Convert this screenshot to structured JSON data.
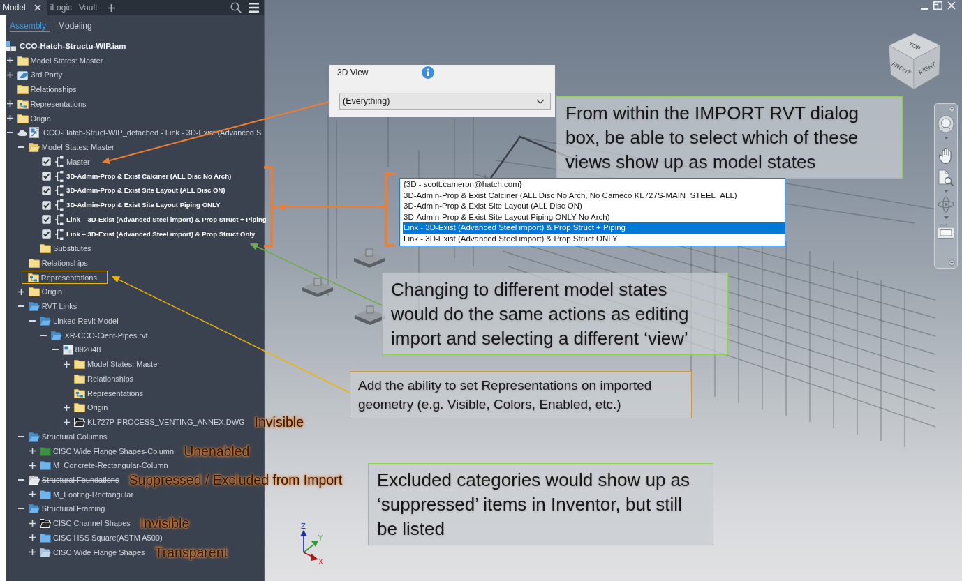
{
  "panel": {
    "tabs": [
      {
        "label": "Model",
        "selected": true,
        "closable": true
      },
      {
        "label": "iLogic",
        "selected": false,
        "closable": false
      },
      {
        "label": "Vault",
        "selected": false,
        "closable": false
      }
    ],
    "view_tabs": [
      {
        "label": "Assembly",
        "selected": true
      },
      {
        "label": "Modeling",
        "selected": false
      }
    ],
    "tree": {
      "label": "CCO-Hatch-Structu-WIP.iam",
      "kind": "assembly",
      "children": [
        {
          "label": "Model States: Master",
          "kind": "folder",
          "expanded": false
        },
        {
          "label": "3rd Party",
          "kind": "third-party",
          "expanded": false
        },
        {
          "label": "Relationships",
          "kind": "folder"
        },
        {
          "label": "Representations",
          "kind": "representations",
          "expanded": false
        },
        {
          "label": "Origin",
          "kind": "folder",
          "expanded": false
        },
        {
          "label": "CCO-Hatch-Struct-WIP_detached - Link - 3D-Exist (Advanced S",
          "kind": "linked-file",
          "expanded": true,
          "children": [
            {
              "label": "Model States: Master",
              "kind": "folder",
              "expanded": true,
              "children": [
                {
                  "label": "Master",
                  "kind": "model-state",
                  "checked": true,
                  "proposed": false
                },
                {
                  "label": "3D-Admin-Prop & Exist Calciner (ALL Disc No Arch)",
                  "kind": "model-state",
                  "checked": true,
                  "proposed": true
                },
                {
                  "label": "3D-Admin-Prop & Exist Site Layout (ALL Disc ON)",
                  "kind": "model-state",
                  "checked": true,
                  "proposed": true
                },
                {
                  "label": "3D-Admin-Prop & Exist Site Layout Piping ONLY",
                  "kind": "model-state",
                  "checked": true,
                  "proposed": true
                },
                {
                  "label": "Link – 3D-Exist (Advanced Steel import) & Prop Struct + Piping",
                  "kind": "model-state",
                  "checked": true,
                  "proposed": true
                },
                {
                  "label": "Link – 3D-Exist (Advanced Steel import) & Prop Struct Only",
                  "kind": "model-state",
                  "checked": true,
                  "proposed": true
                },
                {
                  "label": "Substitutes",
                  "kind": "folder"
                }
              ]
            },
            {
              "label": "Relationships",
              "kind": "folder"
            },
            {
              "label": "Representations",
              "kind": "representations",
              "highlighted": true
            },
            {
              "label": "Origin",
              "kind": "folder",
              "expanded": false
            },
            {
              "label": "RVT Links",
              "kind": "category",
              "expanded": true,
              "children": [
                {
                  "label": "Linked Revit Model",
                  "kind": "category",
                  "expanded": true,
                  "children": [
                    {
                      "label": "XR-CCO-Cient-Pipes.rvt",
                      "kind": "category",
                      "expanded": true,
                      "children": [
                        {
                          "label": "892048",
                          "kind": "revit-model",
                          "expanded": true,
                          "children": [
                            {
                              "label": "Model States: Master",
                              "kind": "folder",
                              "expanded": false
                            },
                            {
                              "label": "Relationships",
                              "kind": "folder"
                            },
                            {
                              "label": "Representations",
                              "kind": "representations"
                            },
                            {
                              "label": "Origin",
                              "kind": "folder",
                              "expanded": false
                            },
                            {
                              "label": "KL727P-PROCESS_VENTING_ANNEX.DWG",
                              "kind": "invisible-category",
                              "expanded": false,
                              "note": "Invisible"
                            }
                          ]
                        }
                      ]
                    }
                  ]
                }
              ]
            },
            {
              "label": "Structural Columns",
              "kind": "category",
              "expanded": true,
              "children": [
                {
                  "label": "CISC Wide Flange Shapes-Column",
                  "kind": "unenabled-category",
                  "expanded": false,
                  "note": "Unenabled"
                },
                {
                  "label": "M_Concrete-Rectangular-Column",
                  "kind": "category",
                  "expanded": false
                }
              ]
            },
            {
              "label": "Structural Foundations",
              "kind": "suppressed-category",
              "expanded": true,
              "note": "Suppressed / Excluded from Import",
              "children": [
                {
                  "label": "M_Footing-Rectangular",
                  "kind": "category",
                  "expanded": false
                }
              ]
            },
            {
              "label": "Structural Framing",
              "kind": "category",
              "expanded": true,
              "children": [
                {
                  "label": "CISC Channel Shapes",
                  "kind": "invisible-category",
                  "expanded": false,
                  "note": "Invisible"
                },
                {
                  "label": "CISC HSS Square(ASTM A500)",
                  "kind": "category",
                  "expanded": false
                },
                {
                  "label": "CISC Wide Flange Shapes",
                  "kind": "transparent-category",
                  "expanded": false,
                  "note": "Transparent"
                }
              ]
            }
          ]
        }
      ]
    }
  },
  "viewport": {
    "view_cube": {
      "top": "TOP",
      "front": "FRONT",
      "right": "RIGHT"
    },
    "axis_triad": {
      "z": "Z",
      "y": "Y",
      "x": "X"
    },
    "import_dialog": {
      "label": "3D View",
      "value": "(Everything)"
    },
    "view_list": [
      {
        "label": "{3D - scott.cameron@hatch.com}",
        "selected": false
      },
      {
        "label": "3D-Admin-Prop & Exist Calciner (ALL Disc No Arch, No Cameco KL727S-MAIN_STEEL_ALL)",
        "selected": false
      },
      {
        "label": "3D-Admin-Prop & Exist Site Layout (ALL Disc ON)",
        "selected": false
      },
      {
        "label": "3D-Admin-Prop & Exist Site Layout Piping ONLY No Arch)",
        "selected": false
      },
      {
        "label": "Link - 3D-Exist (Advanced Steel import) & Prop Struct + Piping",
        "selected": true
      },
      {
        "label": "Link - 3D-Exist (Advanced Steel import) & Prop Struct ONLY",
        "selected": false
      }
    ],
    "callouts": [
      {
        "text": "From within the IMPORT RVT dialog box, be able to select which of these views show up as model states",
        "color": "#92d050"
      },
      {
        "text": "Changing to different model states would do the same actions as editing import and selecting a different ‘view’",
        "color": "#92d050"
      },
      {
        "text": "Add the ability to set Representations on imported geometry (e.g. Visible, Colors, Enabled, etc.)",
        "color": "#c8963e"
      },
      {
        "text": "Excluded categories would show up as ‘suppressed’ items in Inventor, but still be listed",
        "color": "#92d050"
      }
    ]
  }
}
